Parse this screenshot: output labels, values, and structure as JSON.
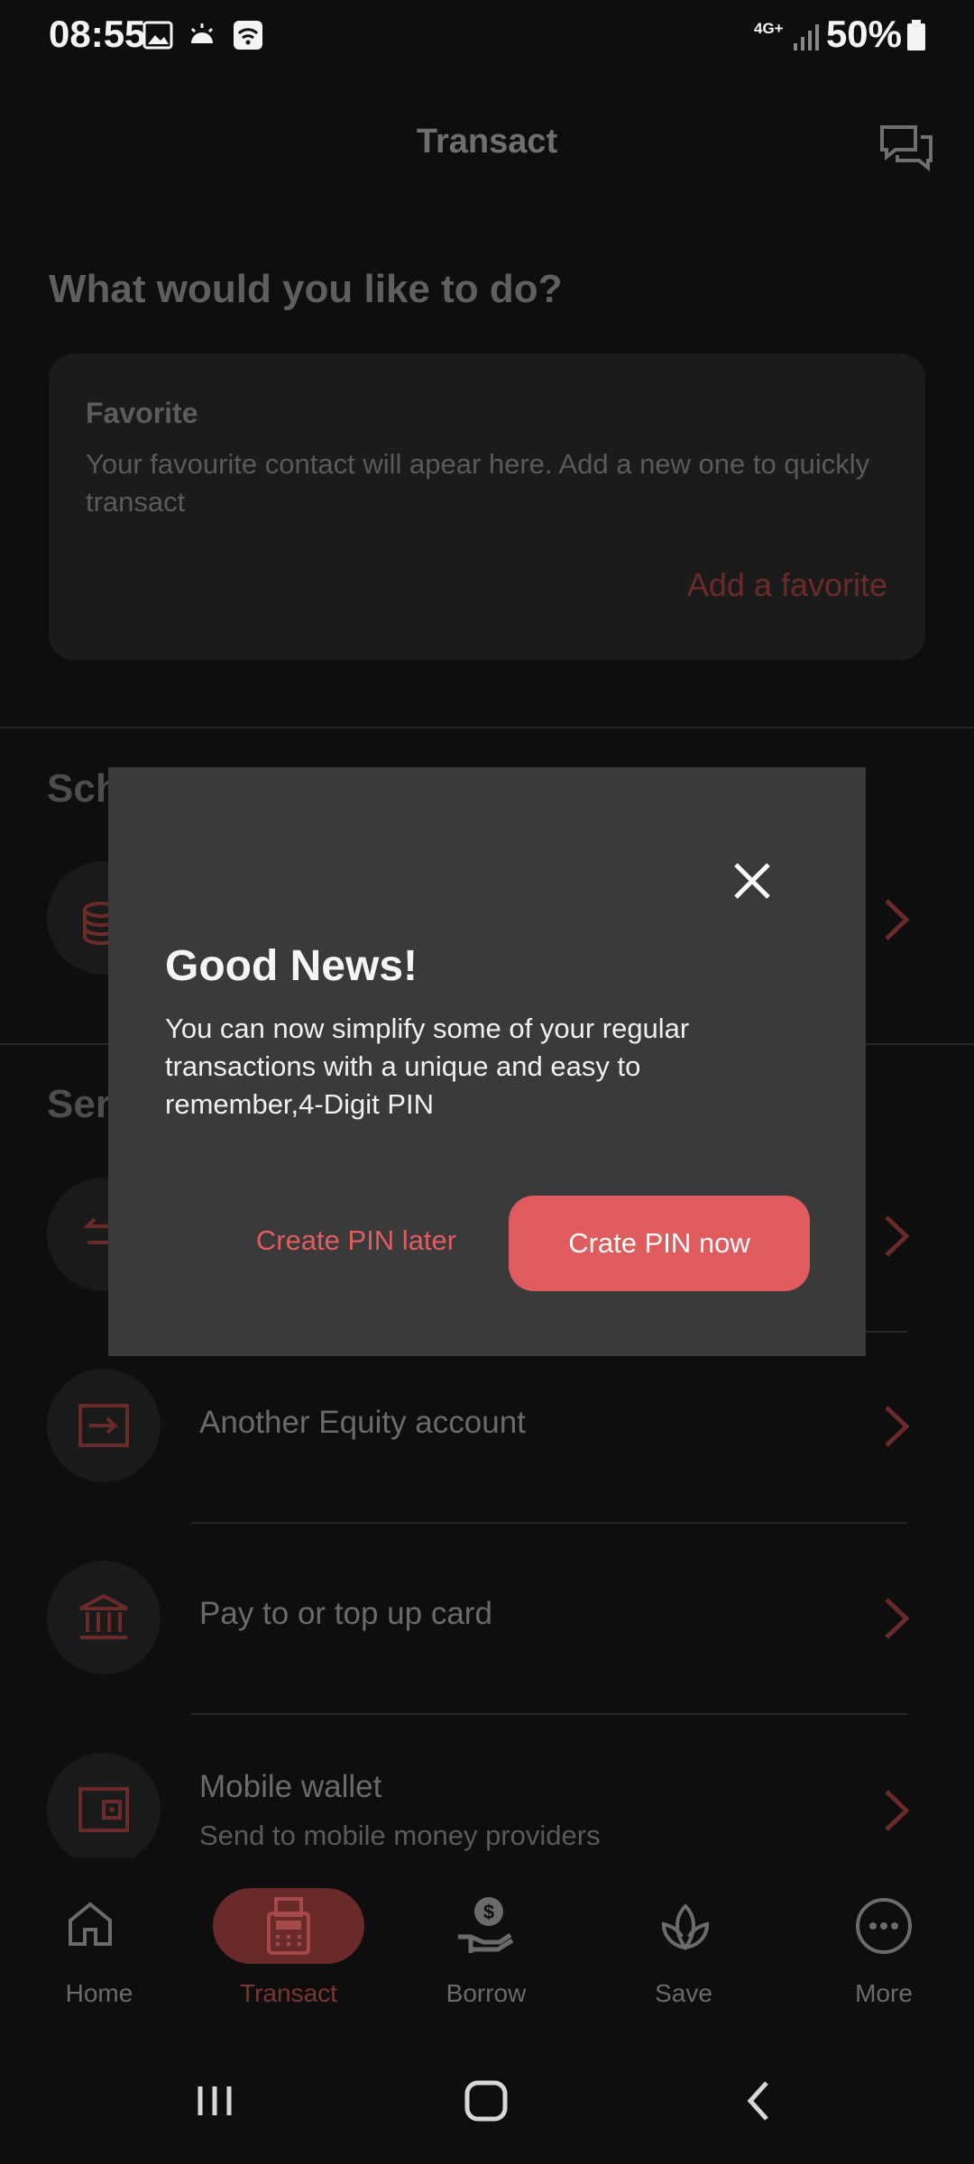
{
  "status_bar": {
    "time": "08:55",
    "network": "4G+",
    "battery": "50%"
  },
  "header": {
    "title": "Transact"
  },
  "intro": {
    "heading": "What would you like to do?"
  },
  "favorite": {
    "title": "Favorite",
    "description": "Your favourite contact will apear here. Add a new one to quickly transact",
    "add_label": "Add a favorite"
  },
  "sections": {
    "scheduled_partial": "Sch",
    "send_partial": "Ser"
  },
  "rows": [
    {
      "label": "Another Equity account",
      "icon": "transfer-in-icon"
    },
    {
      "label": "Pay to or top up card",
      "icon": "bank-icon"
    },
    {
      "label": "Mobile wallet",
      "sub": "Send to mobile money providers",
      "icon": "wallet-icon"
    }
  ],
  "bottom_nav": [
    {
      "label": "Home",
      "icon": "home-icon"
    },
    {
      "label": "Transact",
      "icon": "pos-terminal-icon",
      "active": true
    },
    {
      "label": "Borrow",
      "icon": "hand-money-icon"
    },
    {
      "label": "Save",
      "icon": "leaf-icon"
    },
    {
      "label": "More",
      "icon": "more-dots-icon"
    }
  ],
  "dialog": {
    "title": "Good News!",
    "body": "You can now simplify some of your regular transactions with a unique and easy to remember,4-Digit PIN",
    "secondary_button": "Create PIN later",
    "primary_button": "Crate PIN now"
  },
  "colors": {
    "accent": "#e05b5e",
    "accent_dim": "#6b2a2a",
    "dialog_bg": "#3a3a3b",
    "background": "#0e0e0e"
  }
}
